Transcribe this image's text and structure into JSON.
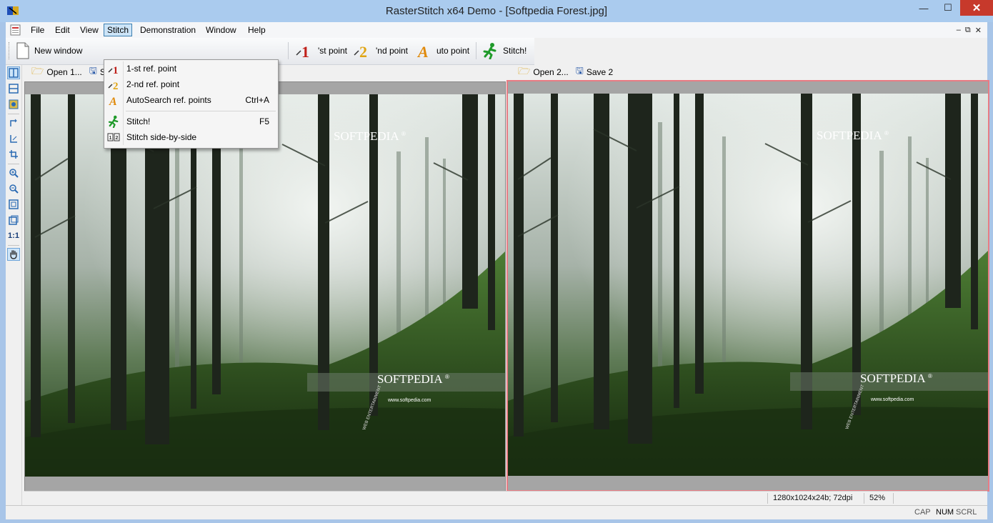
{
  "window": {
    "title": "RasterStitch x64 Demo - [Softpedia Forest.jpg]",
    "minimize_glyph": "—",
    "maximize_glyph": "☐",
    "close_glyph": "✕"
  },
  "menubar": {
    "items": [
      "File",
      "Edit",
      "View",
      "Stitch",
      "Demonstration",
      "Window",
      "Help"
    ],
    "open_menu": "Stitch",
    "mdi_min": "–",
    "mdi_restore": "⧉",
    "mdi_close": "✕"
  },
  "toolbar": {
    "new_window": "New window",
    "ref1": "'st point",
    "ref2": "'nd point",
    "auto": "uto point",
    "stitch": "Stitch!"
  },
  "panel_left": {
    "open": "Open 1...",
    "save": "S"
  },
  "panel_right": {
    "open": "Open 2...",
    "save": "Save 2"
  },
  "image": {
    "watermark": "SOFTPEDIA",
    "watermark_reg": "®",
    "url": "www.softpedia.com",
    "arc_text": "WEB ENTERTAINMENT"
  },
  "stitch_menu": {
    "items": [
      {
        "label": "1-st ref. point",
        "shortcut": "",
        "icon": "ref-point-1-icon"
      },
      {
        "label": "2-nd ref. point",
        "shortcut": "",
        "icon": "ref-point-2-icon"
      },
      {
        "label": "AutoSearch ref. points",
        "shortcut": "Ctrl+A",
        "icon": "auto-search-icon"
      },
      {
        "label": "Stitch!",
        "shortcut": "F5",
        "icon": "stitch-icon"
      },
      {
        "label": "Stitch side-by-side",
        "shortcut": "",
        "icon": "side-by-side-icon"
      }
    ]
  },
  "status": {
    "info": "1280x1024x24b; 72dpi",
    "zoom": "52%"
  },
  "indicators": {
    "cap": "CAP",
    "num": "NUM",
    "scrl": "SCRL"
  },
  "sidebar": {
    "one_to_one": "1:1"
  },
  "colors": {
    "titlebar": "#aacbee",
    "close": "#c7392b",
    "selection": "#cce4f7",
    "pane_border": "#e87c84"
  }
}
